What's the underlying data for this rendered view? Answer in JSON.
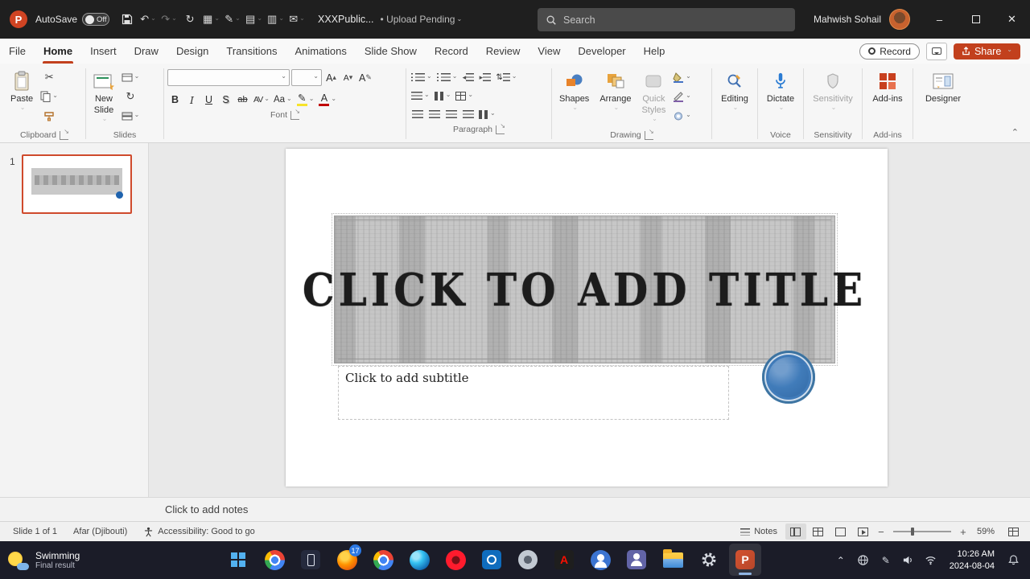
{
  "titlebar": {
    "app_letter": "P",
    "autosave_label": "AutoSave",
    "autosave_state": "Off",
    "doc_title": "XXXPublic...",
    "upload_status": "• Upload Pending",
    "search_placeholder": "Search",
    "user_name": "Mahwish Sohail"
  },
  "icons": {
    "undo": "↶",
    "redo": "↷",
    "rotate": "↻",
    "grid": "▦",
    "panel": "▤",
    "layout": "▥",
    "mail": "✉",
    "scissors": "✂",
    "pen": "✎",
    "up": "▴",
    "down": "▾",
    "updown": "⇅",
    "minimize": "–",
    "close": "✕",
    "collapse": "⌃",
    "hidden_chevron": "⌃"
  },
  "tabs": [
    "File",
    "Home",
    "Insert",
    "Draw",
    "Design",
    "Transitions",
    "Animations",
    "Slide Show",
    "Record",
    "Review",
    "View",
    "Developer",
    "Help"
  ],
  "tab_actions": {
    "record": "Record",
    "share": "Share"
  },
  "ribbon": {
    "clipboard": {
      "paste": "Paste",
      "label": "Clipboard"
    },
    "slides": {
      "new1": "New",
      "new2": "Slide",
      "label": "Slides"
    },
    "font": {
      "bold": "B",
      "italic": "I",
      "underline": "U",
      "shadow": "S",
      "strike": "ab",
      "spacing": "AV",
      "case": "Aa",
      "grow": "A",
      "shrink": "A",
      "clear": "A",
      "color": "A",
      "label": "Font"
    },
    "paragraph": {
      "label": "Paragraph"
    },
    "drawing": {
      "shapes": "Shapes",
      "arrange": "Arrange",
      "quick1": "Quick",
      "quick2": "Styles",
      "label": "Drawing"
    },
    "editing": {
      "button": "Editing"
    },
    "voice": {
      "button": "Dictate",
      "label": "Voice"
    },
    "sensitivity": {
      "button": "Sensitivity",
      "label": "Sensitivity"
    },
    "addins": {
      "button": "Add-ins",
      "label": "Add-ins"
    },
    "designer": {
      "button": "Designer"
    }
  },
  "slide_panel": {
    "number": "1"
  },
  "slide": {
    "title_placeholder": "CLICK TO ADD TITLE",
    "subtitle_placeholder": "Click to add subtitle"
  },
  "notes": {
    "placeholder": "Click to add notes"
  },
  "statusbar": {
    "slide_info": "Slide 1 of 1",
    "language": "Afar (Djibouti)",
    "accessibility": "Accessibility: Good to go",
    "notes_label": "Notes",
    "zoom": "59%"
  },
  "taskbar": {
    "weather_main": "Swimming",
    "weather_sub": "Final result",
    "firefox_badge": "17",
    "adobe_letter": "A",
    "ppt_letter": "P",
    "time": "10:26 AM",
    "date": "2024-08-04"
  }
}
